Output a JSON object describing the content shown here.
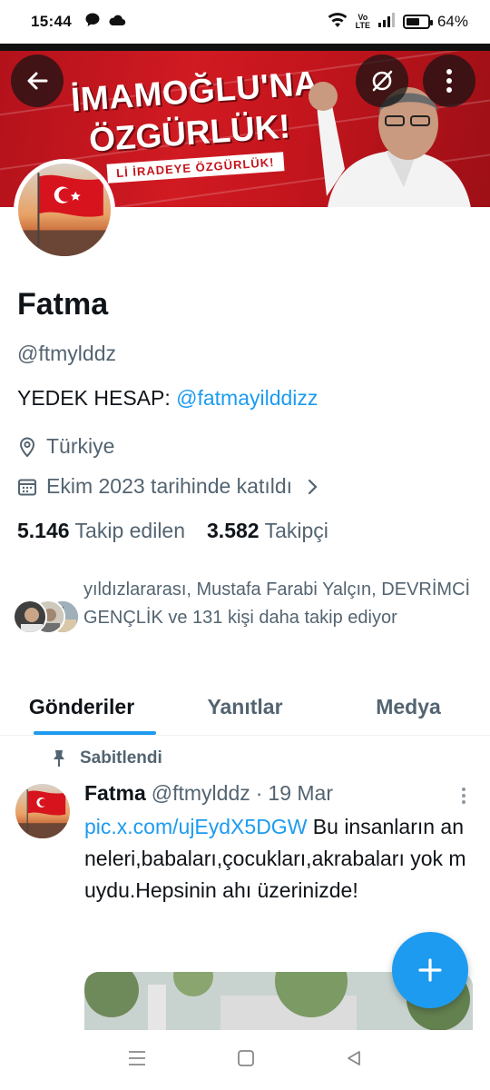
{
  "status_bar": {
    "time": "15:44",
    "battery": "64%",
    "battery_level": 0.64,
    "volte_label": "Vo LTE"
  },
  "banner": {
    "line1": "İMAMOĞLU'NA",
    "line2": "ÖZGÜRLÜK!",
    "sub": "Lİ İRADEYE ÖZGÜRLÜK!"
  },
  "profile": {
    "name": "Fatma",
    "handle": "@ftmylddz",
    "bio_prefix": "YEDEK HESAP: ",
    "bio_mention": "@fatmayilddizz",
    "location": "Türkiye",
    "joined": "Ekim 2023 tarihinde katıldı",
    "following_count": "5.146",
    "following_label": "Takip edilen",
    "followers_count": "3.582",
    "followers_label": "Takipçi",
    "followed_by_text": "yıldızlararası, Mustafa Farabi Yalçın, DEVRİMCİ GENÇLİK ve 131 kişi daha takip ediyor"
  },
  "tabs": [
    {
      "label": "Gönderiler",
      "active": true
    },
    {
      "label": "Yanıtlar",
      "active": false
    },
    {
      "label": "Medya",
      "active": false
    }
  ],
  "pinned_tweet": {
    "pinned_label": "Sabitlendi",
    "author": "Fatma",
    "handle": "@ftmylddz",
    "separator": "·",
    "date": "19 Mar",
    "link": "pic.x.com/ujEydX5DGW",
    "text": " Bu insanların anneleri,babaları,çocukları,akrabaları yok muydu.Hepsinin ahı üzerinizde!"
  },
  "colors": {
    "accent": "#1d9bf0",
    "text_primary": "#0f1419",
    "text_secondary": "#536471",
    "banner_red": "#c4151d"
  },
  "icons": {
    "back": "arrow-left-icon",
    "grok": "grok-icon",
    "more": "more-vertical-icon",
    "location": "location-pin-icon",
    "calendar": "calendar-icon",
    "chevron": "chevron-right-icon",
    "pin": "pin-icon",
    "compose": "plus-icon"
  }
}
